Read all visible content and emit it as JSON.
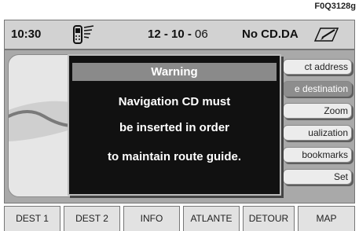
{
  "figure_code": "F0Q3128g",
  "status_bar": {
    "time": "10:30",
    "date_day_month": "12 - 10 -",
    "date_year": " 06",
    "cd_status": "No CD.DA",
    "phone_icon": "mobile-phone-signal-icon",
    "pen_icon": "pen-notepad-icon"
  },
  "side_menu": {
    "items": [
      {
        "label": "ct address",
        "active": false
      },
      {
        "label": "e destination",
        "active": true
      },
      {
        "label": "Zoom",
        "active": false
      },
      {
        "label": "ualization",
        "active": false
      },
      {
        "label": "bookmarks",
        "active": false
      },
      {
        "label": "Set",
        "active": false
      }
    ]
  },
  "dialog": {
    "title": "Warning",
    "line1": "Navigation CD must",
    "line2": "be inserted in order",
    "line3": "to maintain route guide."
  },
  "softkeys": [
    {
      "label": "DEST 1"
    },
    {
      "label": "DEST 2"
    },
    {
      "label": "INFO"
    },
    {
      "label": "ATLANTE"
    },
    {
      "label": "DETOUR"
    },
    {
      "label": "MAP"
    }
  ],
  "colors": {
    "frame_grey": "#a9a9a9",
    "status_bg": "#d2d2d2",
    "dialog_bg": "#111111",
    "dialog_title_bg": "#8a8a8a",
    "menu_active_bg": "#8d8d8d"
  }
}
